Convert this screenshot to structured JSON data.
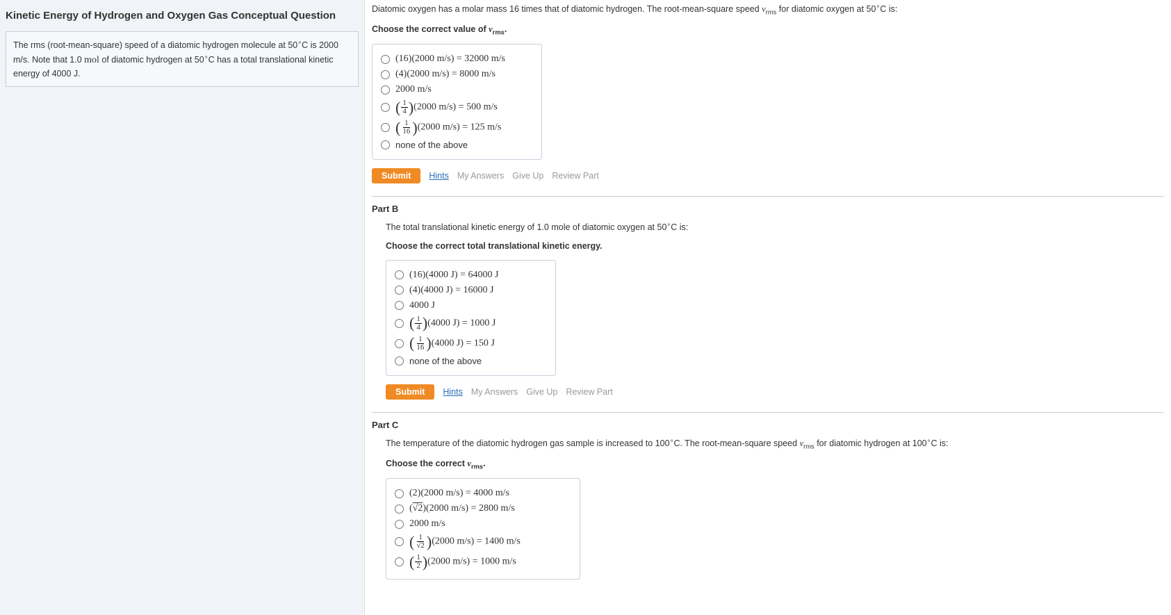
{
  "left": {
    "title": "Kinetic Energy of Hydrogen and Oxygen Gas Conceptual Question",
    "info": "The rms (root-mean-square) speed of a diatomic hydrogen molecule at 50°C is 2000 m/s. Note that 1.0 mol of diatomic hydrogen at 50°C has a total translational kinetic energy of 4000 J."
  },
  "partA": {
    "intro": "Diatomic oxygen has a molar mass 16 times that of diatomic hydrogen. The root-mean-square speed vrms for diatomic oxygen at 50°C is:",
    "prompt": "Choose the correct value of vrms.",
    "choices": [
      "(16)(2000 m/s) = 32000 m/s",
      "(4)(2000 m/s) = 8000 m/s",
      "2000 m/s",
      "(1/4)(2000 m/s) = 500 m/s",
      "(1/16)(2000 m/s) = 125 m/s",
      "none of the above"
    ]
  },
  "partB": {
    "label": "Part B",
    "intro": "The total translational kinetic energy of 1.0 mole of diatomic oxygen at 50°C is:",
    "prompt": "Choose the correct total translational kinetic energy.",
    "choices": [
      "(16)(4000 J) = 64000 J",
      "(4)(4000 J) = 16000 J",
      "4000 J",
      "(1/4)(4000 J) = 1000 J",
      "(1/16)(4000 J) = 150 J",
      "none of the above"
    ]
  },
  "partC": {
    "label": "Part C",
    "intro": "The temperature of the diatomic hydrogen gas sample is increased to 100°C. The root-mean-square speed vrms for diatomic hydrogen at 100°C is:",
    "prompt": "Choose the correct vrms.",
    "choices": [
      "(2)(2000 m/s) = 4000 m/s",
      "(√2)(2000 m/s) = 2800 m/s",
      "2000 m/s",
      "(1/√2)(2000 m/s) = 1400 m/s",
      "(1/2)(2000 m/s) = 1000 m/s"
    ]
  },
  "actions": {
    "submit": "Submit",
    "hints": "Hints",
    "my_answers": "My Answers",
    "give_up": "Give Up",
    "review": "Review Part"
  }
}
